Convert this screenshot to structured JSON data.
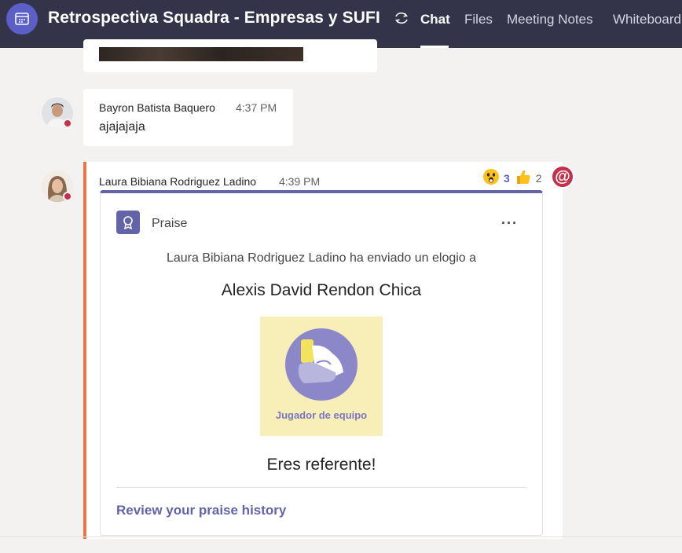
{
  "header": {
    "title": "Retrospectiva Squadra - Empresas y SUFI",
    "tabs": [
      {
        "label": "Chat",
        "active": true
      },
      {
        "label": "Files",
        "active": false
      },
      {
        "label": "Meeting Notes",
        "active": false
      },
      {
        "label": "Whiteboard",
        "active": false
      }
    ],
    "colors": {
      "header_bg": "#33344a",
      "accent": "#5b5fc7"
    }
  },
  "messages": [
    {
      "author": "Bayron Batista Baquero",
      "time": "4:37 PM",
      "text": "ajajajaja",
      "status": "busy"
    },
    {
      "author": "Laura Bibiana Rodriguez Ladino",
      "time": "4:39 PM",
      "reactions": [
        {
          "icon": "surprised-emoji-icon",
          "count": "3"
        },
        {
          "icon": "thumbs-up-emoji-icon",
          "count": "2"
        }
      ],
      "mention_icon": "at-mention-icon",
      "status": "busy"
    }
  ],
  "praise_card": {
    "label": "Praise",
    "more_label": "···",
    "sent_text": "Laura Bibiana Rodriguez Ladino ha enviado un elogio a",
    "recipient": "Alexis David Rendon Chica",
    "badge_label": "Jugador de equipo",
    "message": "Eres referente!",
    "review_link": "Review your praise history",
    "colors": {
      "accent": "#6264a7",
      "badge_bg": "#f8eeb8",
      "badge_circle": "#8c87c8"
    }
  }
}
